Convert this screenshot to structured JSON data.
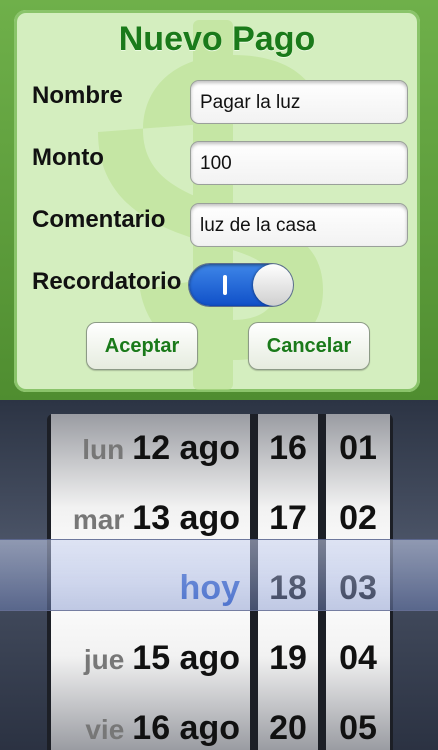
{
  "form": {
    "title": "Nuevo Pago",
    "fields": [
      {
        "label": "Nombre",
        "value": "Pagar la luz"
      },
      {
        "label": "Monto",
        "value": "100"
      },
      {
        "label": "Comentario",
        "value": "luz de la casa"
      }
    ],
    "reminder": {
      "label": "Recordatorio",
      "state_text": "I",
      "on": true
    },
    "accept_label": "Aceptar",
    "cancel_label": "Cancelar",
    "colors": {
      "title": "#1a7a1a",
      "toggle_on": "#1f64d8"
    }
  },
  "picker": {
    "dates": [
      {
        "weekday": "lun",
        "date": "12 ago"
      },
      {
        "weekday": "mar",
        "date": "13 ago"
      },
      {
        "weekday": "",
        "date": "hoy"
      },
      {
        "weekday": "jue",
        "date": "15 ago"
      },
      {
        "weekday": "vie",
        "date": "16 ago"
      }
    ],
    "hours": [
      "16",
      "17",
      "18",
      "19",
      "20"
    ],
    "minutes": [
      "01",
      "02",
      "03",
      "04",
      "05"
    ],
    "selected_index": 2
  }
}
